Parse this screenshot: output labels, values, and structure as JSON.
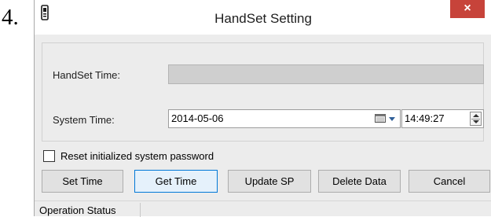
{
  "step_number": "4.",
  "window": {
    "title": "HandSet Setting",
    "close_glyph": "×",
    "icon": "handset-icon"
  },
  "form": {
    "handset_time_label": "HandSet Time:",
    "handset_time_value": "",
    "system_time_label": "System Time:",
    "system_date_value": "2014-05-06",
    "system_time_value": "14:49:27",
    "reset_password_label": "Reset initialized system password",
    "reset_password_checked": false
  },
  "buttons": {
    "set_time": "Set Time",
    "get_time": "Get Time",
    "update_sp": "Update SP",
    "delete_data": "Delete Data",
    "cancel": "Cancel"
  },
  "status_bar": {
    "label": "Operation Status"
  },
  "colors": {
    "close_button": "#c7433a",
    "focus_border": "#0078d7",
    "dropdown_arrow": "#2f5f98"
  }
}
